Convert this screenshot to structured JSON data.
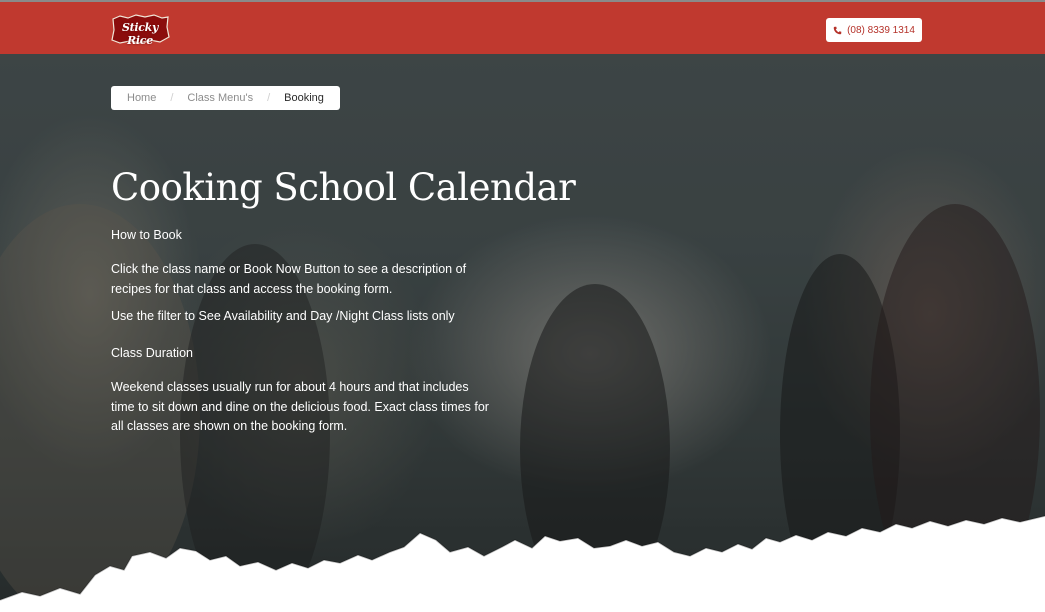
{
  "header": {
    "logo_text": "Sticky Rice",
    "phone_label": "(08) 8339 1314",
    "icons": {
      "phone": "phone-icon"
    }
  },
  "breadcrumb": {
    "items": [
      {
        "label": "Home"
      },
      {
        "label": "Class Menu's"
      },
      {
        "label": "Booking"
      }
    ],
    "separator": "/"
  },
  "hero": {
    "title": "Cooking School Calendar",
    "how_to_book_heading": "How to Book",
    "how_to_book_text": "Click the class name or Book Now Button to see a description of recipes for that class and access the booking form.",
    "filter_text": "Use the filter to See Availability and Day /Night Class lists only",
    "duration_heading": "Class Duration",
    "duration_text": "Weekend classes usually run for about 4 hours and that includes time to sit down and dine on the delicious food. Exact class times for all classes are shown on the booking form."
  },
  "colors": {
    "brand_red": "#c0392f",
    "text_on_hero": "#ffffff"
  }
}
